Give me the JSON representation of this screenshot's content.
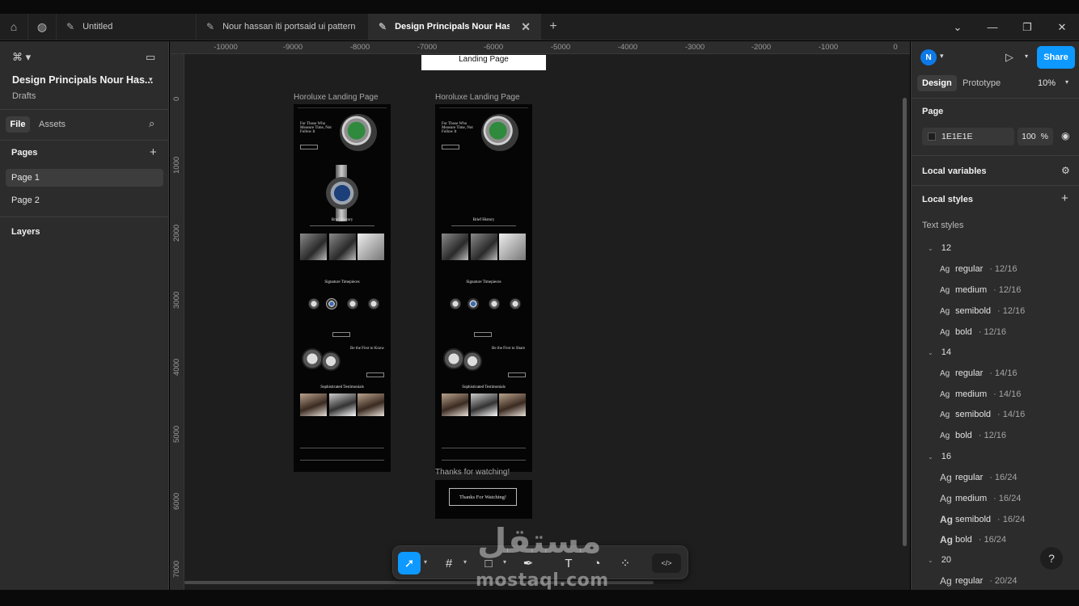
{
  "tabs": {
    "items": [
      {
        "label": "Untitled"
      },
      {
        "label": "Nour hassan iti portsaid ui pattern"
      },
      {
        "label": "Design Principals Nour Hassan Pr"
      }
    ]
  },
  "left_panel": {
    "file_title": "Design Principals Nour Has...",
    "location": "Drafts",
    "file_tab": "File",
    "assets_tab": "Assets",
    "pages_heading": "Pages",
    "pages": [
      {
        "label": "Page 1"
      },
      {
        "label": "Page 2"
      }
    ],
    "layers_heading": "Layers"
  },
  "canvas": {
    "ruler_x": [
      "-10000",
      "-9000",
      "-8000",
      "-7000",
      "-6000",
      "-5000",
      "-4000",
      "-3000",
      "-2000",
      "-1000",
      "0"
    ],
    "ruler_y": [
      "0",
      "1000",
      "2000",
      "3000",
      "4000",
      "5000",
      "6000",
      "7000"
    ],
    "landing_box_label": "Landing Page",
    "frame1_label": "Horoluxe Landing Page",
    "frame2_label": "Horoluxe Landing Page",
    "thanks_label": "Thanks for watching!",
    "thanks_button": "Thanks For Watching!",
    "mini": {
      "hero_heading": "For Those Who Measure Time, Not Follow It",
      "brief_history": "Brief History",
      "signature": "Signature Timepieces",
      "first_know": "Be the First to Know",
      "first_share": "Be the First to Share",
      "testimonials": "Sophisticated Testimonials"
    }
  },
  "right_panel": {
    "avatar_initial": "N",
    "share_label": "Share",
    "design_tab": "Design",
    "prototype_tab": "Prototype",
    "zoom": "10%",
    "page_heading": "Page",
    "page_color": "1E1E1E",
    "page_opacity": "100",
    "percent": "%",
    "local_variables": "Local variables",
    "local_styles": "Local styles",
    "text_styles": "Text styles",
    "groups": [
      {
        "size": "12",
        "styles": [
          {
            "name": "regular",
            "spec": "12/16"
          },
          {
            "name": "medium",
            "spec": "12/16"
          },
          {
            "name": "semibold",
            "spec": "12/16"
          },
          {
            "name": "bold",
            "spec": "12/16"
          }
        ]
      },
      {
        "size": "14",
        "styles": [
          {
            "name": "regular",
            "spec": "14/16"
          },
          {
            "name": "medium",
            "spec": "14/16"
          },
          {
            "name": "semibold",
            "spec": "14/16"
          },
          {
            "name": "bold",
            "spec": "12/16"
          }
        ]
      },
      {
        "size": "16",
        "styles": [
          {
            "name": "regular",
            "spec": "16/24"
          },
          {
            "name": "medium",
            "spec": "16/24"
          },
          {
            "name": "semibold",
            "spec": "16/24"
          },
          {
            "name": "bold",
            "spec": "16/24"
          }
        ]
      },
      {
        "size": "20",
        "styles": [
          {
            "name": "regular",
            "spec": "20/24"
          }
        ]
      }
    ],
    "ag": "Ag",
    "dot": "·"
  },
  "watermark": {
    "arabic": "مستقل",
    "latin": "mostaql.com"
  },
  "colors": {
    "accent": "#0d99ff",
    "canvas": "#1e1e1e",
    "panel": "#2c2c2c"
  }
}
